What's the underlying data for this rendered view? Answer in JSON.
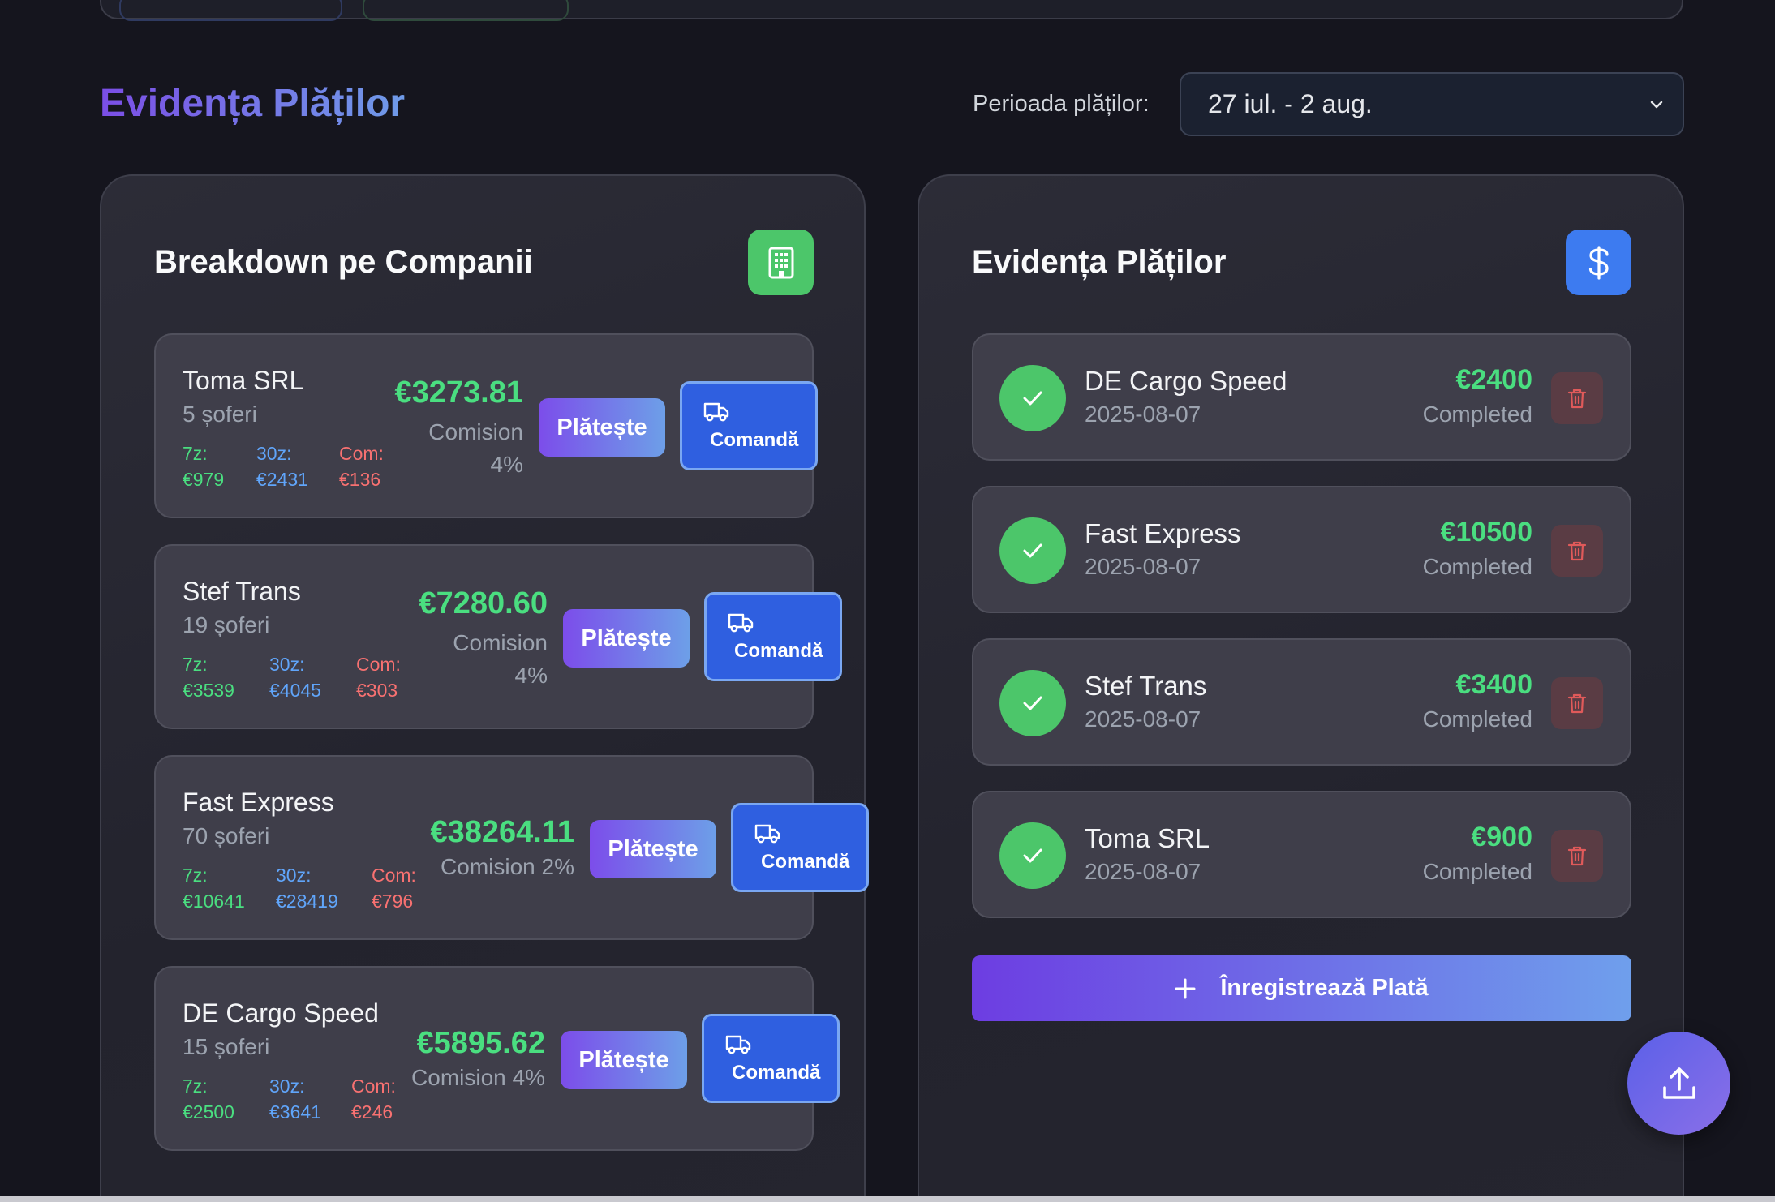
{
  "header": {
    "title": "Evidența Plăților",
    "period_label": "Perioada plăților:",
    "period_value": "27 iul. - 2 aug."
  },
  "companies_card": {
    "title": "Breakdown pe Companii",
    "icon": "building-icon",
    "items": [
      {
        "name": "Toma SRL",
        "drivers": "5 șoferi",
        "s7_label": "7z:",
        "s7_value": "€979",
        "s30_label": "30z:",
        "s30_value": "€2431",
        "com_label": "Com:",
        "com_value": "€136",
        "amount": "€3273.81",
        "commission_word": "Comision",
        "commission_pct": "4%",
        "pay_label": "Plătește",
        "order_label": "Comandă"
      },
      {
        "name": "Stef Trans",
        "drivers": "19 șoferi",
        "s7_label": "7z:",
        "s7_value": "€3539",
        "s30_label": "30z:",
        "s30_value": "€4045",
        "com_label": "Com:",
        "com_value": "€303",
        "amount": "€7280.60",
        "commission_word": "Comision",
        "commission_pct": "4%",
        "pay_label": "Plătește",
        "order_label": "Comandă"
      },
      {
        "name": "Fast Express",
        "drivers": "70 șoferi",
        "s7_label": "7z:",
        "s7_value": "€10641",
        "s30_label": "30z:",
        "s30_value": "€28419",
        "com_label": "Com:",
        "com_value": "€796",
        "amount": "€38264.11",
        "commission_word": "Comision 2%",
        "commission_pct": "",
        "pay_label": "Plătește",
        "order_label": "Comandă"
      },
      {
        "name": "DE Cargo Speed",
        "drivers": "15 șoferi",
        "s7_label": "7z:",
        "s7_value": "€2500",
        "s30_label": "30z:",
        "s30_value": "€3641",
        "com_label": "Com:",
        "com_value": "€246",
        "amount": "€5895.62",
        "commission_word": "Comision 4%",
        "commission_pct": "",
        "pay_label": "Plătește",
        "order_label": "Comandă"
      }
    ]
  },
  "payments_card": {
    "title": "Evidența Plăților",
    "icon": "dollar-icon",
    "items": [
      {
        "name": "DE Cargo Speed",
        "date": "2025-08-07",
        "amount": "€2400",
        "status": "Completed"
      },
      {
        "name": "Fast Express",
        "date": "2025-08-07",
        "amount": "€10500",
        "status": "Completed"
      },
      {
        "name": "Stef Trans",
        "date": "2025-08-07",
        "amount": "€3400",
        "status": "Completed"
      },
      {
        "name": "Toma SRL",
        "date": "2025-08-07",
        "amount": "€900",
        "status": "Completed"
      }
    ],
    "register_label": "Înregistrează Plată"
  },
  "colors": {
    "accent_green": "#4ade80",
    "accent_blue": "#2f5fe0",
    "accent_purple": "#7c4dea",
    "danger": "#f87171"
  }
}
